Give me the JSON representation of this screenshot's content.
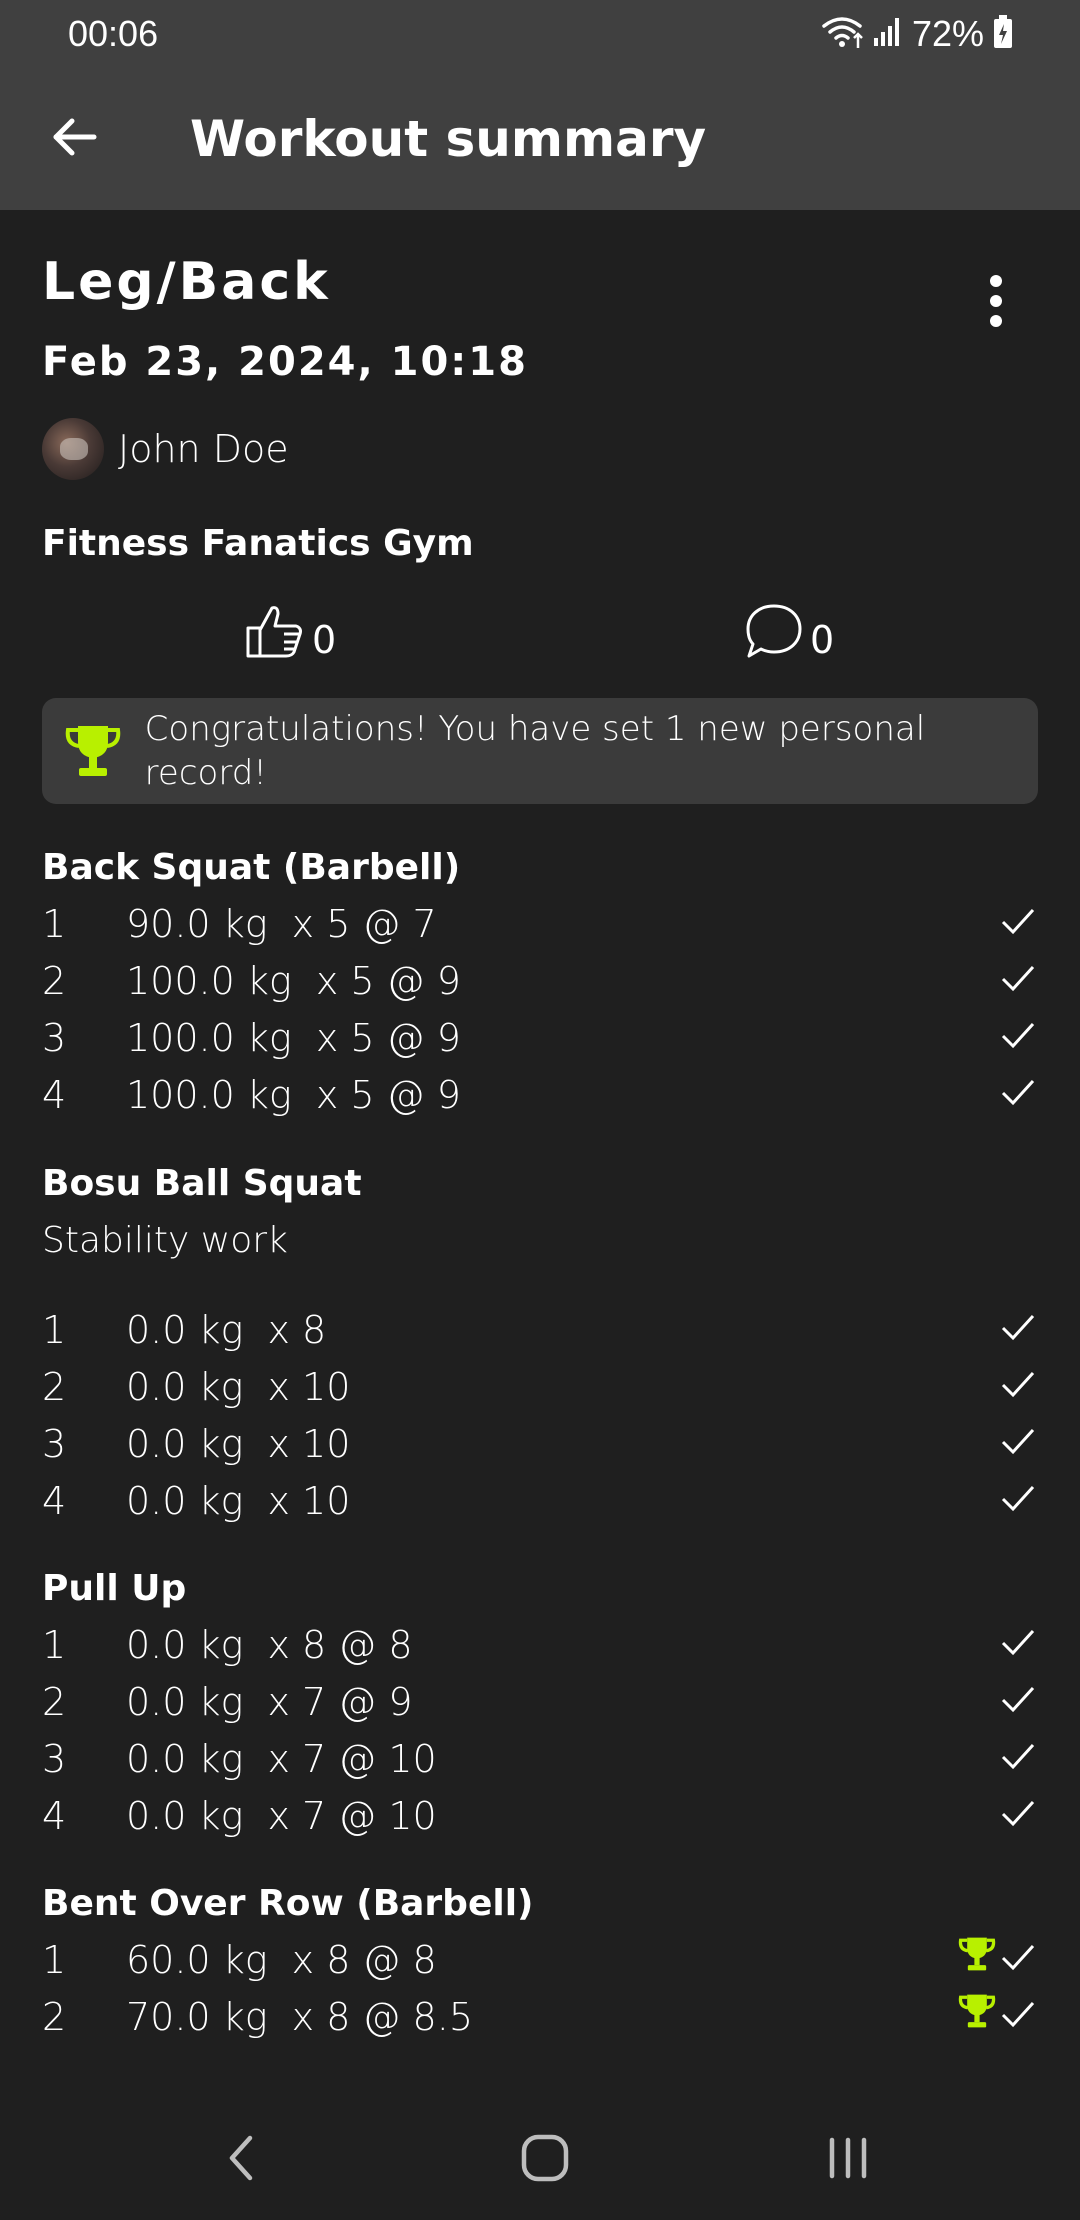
{
  "status_bar": {
    "time": "00:06",
    "battery_percent": "72%",
    "icons": [
      "wifi-icon",
      "signal-icon",
      "battery-charging-icon"
    ]
  },
  "app_bar": {
    "title": "Workout summary",
    "back_icon": "back-arrow-icon"
  },
  "workout": {
    "name": "Leg/Back",
    "date": "Feb 23, 2024, 10:18",
    "user": "John Doe",
    "gym": "Fitness Fanatics Gym",
    "likes": "0",
    "comments": "0"
  },
  "pr_banner": {
    "text": "Congratulations! You have set 1 new personal record!",
    "icon": "trophy-icon"
  },
  "exercises": [
    {
      "title": "Back Squat (Barbell)",
      "note": "",
      "sets": [
        {
          "num": "1",
          "detail": "90.0 kg  x 5 @ 7",
          "pr": false
        },
        {
          "num": "2",
          "detail": "100.0 kg  x 5 @ 9",
          "pr": false
        },
        {
          "num": "3",
          "detail": "100.0 kg  x 5 @ 9",
          "pr": false
        },
        {
          "num": "4",
          "detail": "100.0 kg  x 5 @ 9",
          "pr": false
        }
      ]
    },
    {
      "title": "Bosu Ball Squat",
      "note": "Stability work",
      "sets": [
        {
          "num": "1",
          "detail": "0.0 kg  x 8",
          "pr": false
        },
        {
          "num": "2",
          "detail": "0.0 kg  x 10",
          "pr": false
        },
        {
          "num": "3",
          "detail": "0.0 kg  x 10",
          "pr": false
        },
        {
          "num": "4",
          "detail": "0.0 kg  x 10",
          "pr": false
        }
      ]
    },
    {
      "title": "Pull Up",
      "note": "",
      "sets": [
        {
          "num": "1",
          "detail": "0.0 kg  x 8 @ 8",
          "pr": false
        },
        {
          "num": "2",
          "detail": "0.0 kg  x 7 @ 9",
          "pr": false
        },
        {
          "num": "3",
          "detail": "0.0 kg  x 7 @ 10",
          "pr": false
        },
        {
          "num": "4",
          "detail": "0.0 kg  x 7 @ 10",
          "pr": false
        }
      ]
    },
    {
      "title": "Bent Over Row (Barbell)",
      "note": "",
      "sets": [
        {
          "num": "1",
          "detail": "60.0 kg  x 8 @ 8",
          "pr": true
        },
        {
          "num": "2",
          "detail": "70.0 kg  x 8 @ 8.5",
          "pr": true
        }
      ]
    }
  ],
  "colors": {
    "background": "#1f1f1f",
    "app_bar": "#404040",
    "banner": "#3b3b3b",
    "accent_trophy": "#b8f000",
    "text": "#ffffff"
  },
  "nav_bar": {
    "icons": [
      "nav-back-icon",
      "nav-home-icon",
      "nav-recents-icon"
    ]
  }
}
